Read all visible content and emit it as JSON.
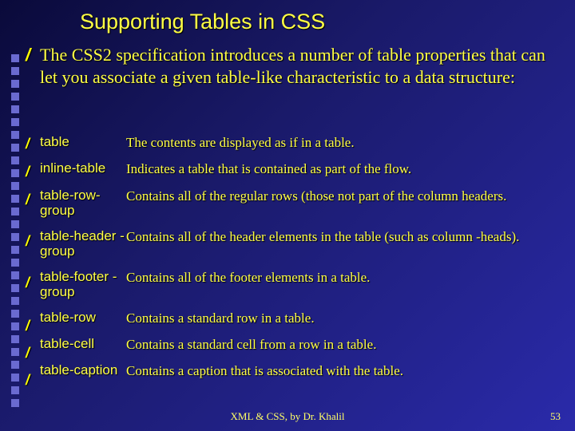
{
  "title": "Supporting Tables in CSS",
  "intro": "The CSS2 specification introduces a number of table properties that can let you associate a given table-like characteristic to a data structure:",
  "items": [
    {
      "term": "table",
      "desc": "The  contents are displayed as if in a table."
    },
    {
      "term": "inline-table",
      "desc": "Indicates a table that is contained as part of the flow."
    },
    {
      "term": "table-row-group",
      "desc": "Contains all of the regular rows (those not part of the column headers."
    },
    {
      "term": "table-header -group",
      "desc": "Contains all of the header elements in the table (such as column -heads)."
    },
    {
      "term": "table-footer -group",
      "desc": "Contains all of the footer elements in a table."
    },
    {
      "term": "table-row",
      "desc": "Contains a standard row in a table."
    },
    {
      "term": "table-cell",
      "desc": "Contains a standard cell from a row in a table."
    },
    {
      "term": "table-caption",
      "desc": "Contains a caption that is associated with the table."
    }
  ],
  "footer_center": "XML & CSS, by Dr. Khalil",
  "footer_right": "53",
  "bullet_glyph": "/"
}
